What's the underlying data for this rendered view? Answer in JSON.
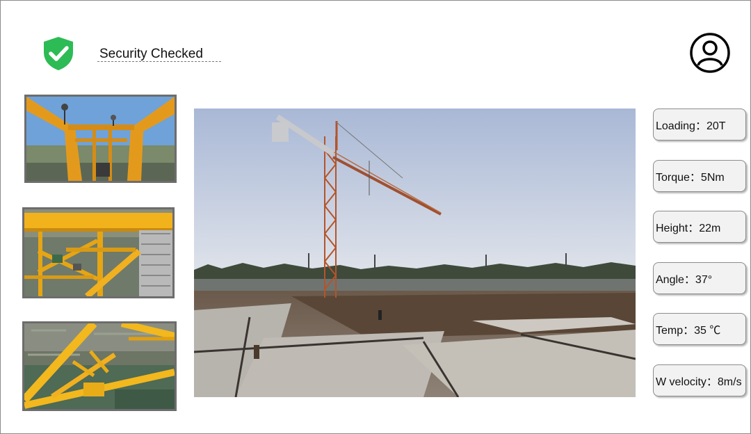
{
  "header": {
    "status_text": "Security Checked",
    "status_icon": "shield-check-icon",
    "status_color": "#2dbb55",
    "profile_icon": "user-profile-icon"
  },
  "thumbnails": [
    {
      "name": "crane-cab-sensor-photo"
    },
    {
      "name": "crane-platform-photo"
    },
    {
      "name": "crane-jib-detail-photo"
    }
  ],
  "main_view": {
    "name": "tower-crane-site-photo"
  },
  "metrics": [
    {
      "label": "Loading",
      "value": "20T",
      "text": "Loading：20T"
    },
    {
      "label": "Torque",
      "value": "5Nm",
      "text": "Torque：5Nm"
    },
    {
      "label": "Height",
      "value": "22m",
      "text": "Height：22m"
    },
    {
      "label": "Angle",
      "value": "37°",
      "text": "Angle：37°"
    },
    {
      "label": "Temp",
      "value": "35 ℃",
      "text": "Temp：35 ℃"
    },
    {
      "label": "W velocity",
      "value": "8m/s",
      "text": "W velocity：8m/s"
    }
  ]
}
